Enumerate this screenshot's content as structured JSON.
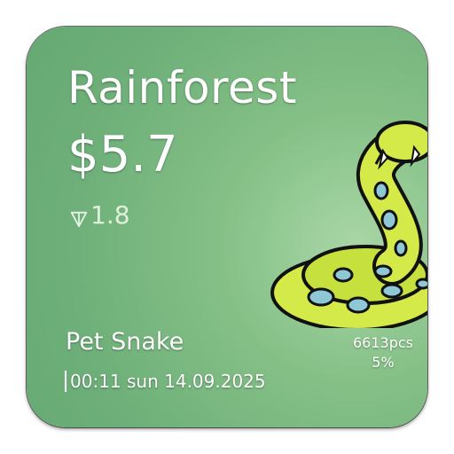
{
  "collection_name": "Rainforest",
  "price": "$5.7",
  "ton_price": "1.8",
  "item_name": "Pet Snake",
  "timestamp": "00:11 sun 14.09.2025",
  "quantity": "6613pcs",
  "percentage": "5%",
  "colors": {
    "card_background": "#7cba80",
    "snake_body": "#d4ea49",
    "snake_spots": "#8ec8d6",
    "outline": "#111111"
  },
  "icons": [
    "ton-icon",
    "snake-illustration"
  ]
}
